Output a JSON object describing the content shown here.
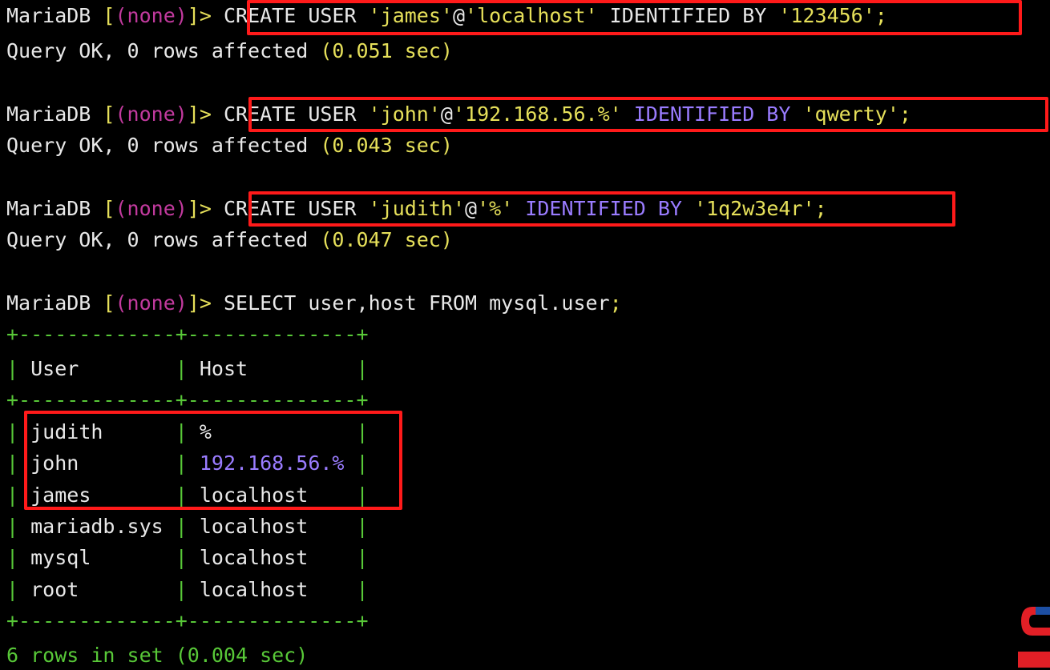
{
  "prompt": {
    "name": "MariaDB",
    "open": "[",
    "db": "(none)",
    "close": "]>"
  },
  "commands": [
    {
      "kw": "CREATE USER ",
      "user": "'james'",
      "at": "@",
      "host": "'localhost'",
      "ident": " IDENTIFIED BY ",
      "pass": "'123456'",
      "end": ";",
      "result": "Query OK, 0 rows affected ",
      "time": "(0.051 sec)"
    },
    {
      "kw": "CREATE USER ",
      "user": "'john'",
      "at": "@",
      "host": "'192.168.56.%'",
      "ident": " IDENTIFIED BY ",
      "pass": "'qwerty'",
      "end": ";",
      "result": "Query OK, 0 rows affected ",
      "time": "(0.043 sec)"
    },
    {
      "kw": "CREATE USER ",
      "user": "'judith'",
      "at": "@",
      "host": "'%'",
      "ident": " IDENTIFIED BY ",
      "pass": "'1q2w3e4r'",
      "end": ";",
      "result": "Query OK, 0 rows affected ",
      "time": "(0.047 sec)"
    }
  ],
  "select": {
    "sql": "SELECT user,host FROM mysql.user",
    "end": ";"
  },
  "table": {
    "border": "+-------------+--------------+",
    "headers": [
      "User",
      "Host"
    ],
    "rows": [
      [
        "judith",
        "%"
      ],
      [
        "john",
        "192.168.56.%"
      ],
      [
        "james",
        "localhost"
      ],
      [
        "mariadb.sys",
        "localhost"
      ],
      [
        "mysql",
        "localhost"
      ],
      [
        "root",
        "localhost"
      ]
    ]
  },
  "footer": "6 rows in set (0.004 sec)",
  "colors": {
    "background": "#000000",
    "text": "#e8e8e8",
    "string": "#e6e05a",
    "prompt_db": "#c23a9e",
    "keyword_purple": "#9a7cff",
    "number": "#f0a860",
    "table_border": "#58c838",
    "highlight_box": "#ff1a1a"
  },
  "logo_icon": "brand-logo-icon"
}
